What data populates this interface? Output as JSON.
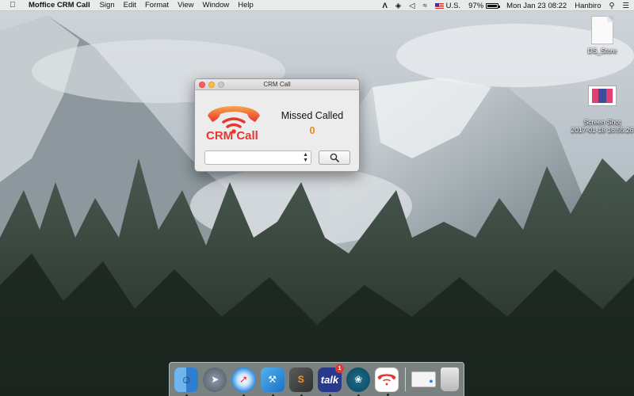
{
  "menubar": {
    "app_name": "Moffice CRM Call",
    "menus": [
      "Sign",
      "Edit",
      "Format",
      "View",
      "Window",
      "Help"
    ],
    "input_source": "U.S.",
    "battery": "97%",
    "datetime": "Mon Jan 23  08:22",
    "user": "Hanbiro"
  },
  "desktop": {
    "icons": [
      {
        "label": "DS_Store"
      },
      {
        "label": "Screen Shot\n2017-01-18 16.55.26"
      }
    ]
  },
  "window": {
    "title": "CRM Call",
    "logo_text": "CRM Call",
    "missed_label": "Missed Called",
    "missed_count": "0",
    "combo_value": ""
  },
  "dock": {
    "items": [
      "finder",
      "launchpad",
      "safari",
      "xcode",
      "sublime-text",
      "talk",
      "tree-app",
      "crm-call",
      "mail",
      "trash"
    ],
    "talk_label": "talk",
    "talk_badge": "1"
  },
  "colors": {
    "brand_red": "#e8352e",
    "missed_orange": "#f08a24"
  }
}
